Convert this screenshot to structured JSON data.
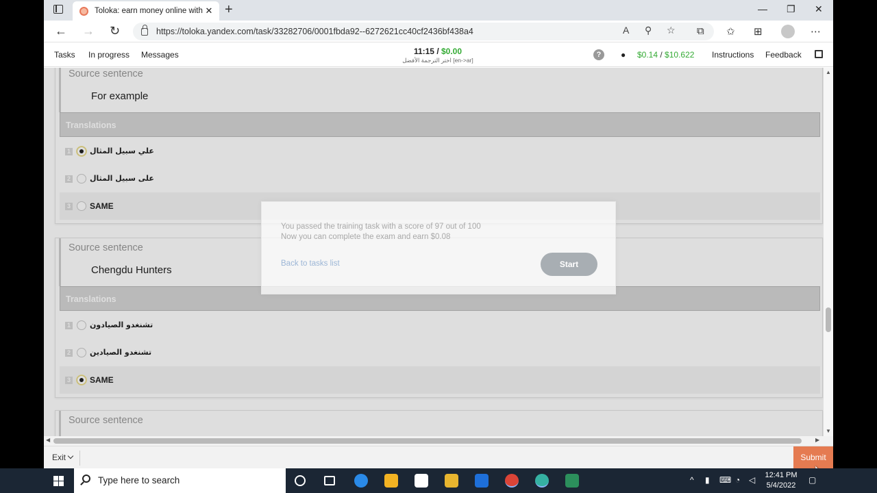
{
  "browser": {
    "tab_title": "Toloka: earn money online with a",
    "tab_close": "✕",
    "new_tab": "+",
    "url": "https://toloka.yandex.com/task/33282706/0001fbda92--6272621cc40cf2436bf438a4",
    "window_controls": [
      "—",
      "❐",
      "✕"
    ]
  },
  "toloka": {
    "nav": [
      "Tasks",
      "In progress",
      "Messages"
    ],
    "timer": "11:15",
    "timer_sep": " / ",
    "task_reward": "$0.00",
    "task_name": "اختر الترجمة الأفضل [en->ar]",
    "help": "?",
    "balance_a": "$0.14",
    "balance_sep": " / ",
    "balance_b": "$10.622",
    "instructions": "Instructions",
    "feedback": "Feedback"
  },
  "tasks": [
    {
      "source_label": "Source sentence",
      "source_text": "For example",
      "translations_label": "Translations",
      "options": [
        {
          "num": "1",
          "text": "علي سبيل المثال",
          "selected": true
        },
        {
          "num": "2",
          "text": "على سبيل المثال",
          "selected": false
        },
        {
          "num": "3",
          "text": "SAME",
          "selected": false
        }
      ]
    },
    {
      "source_label": "Source sentence",
      "source_text": "Chengdu Hunters",
      "translations_label": "Translations",
      "options": [
        {
          "num": "1",
          "text": "تشنغدو الصيادون",
          "selected": false
        },
        {
          "num": "2",
          "text": "تشنغدو الصيادين",
          "selected": false
        },
        {
          "num": "3",
          "text": "SAME",
          "selected": true
        }
      ]
    },
    {
      "source_label": "Source sentence"
    }
  ],
  "modal": {
    "line1": "You passed the training task with a score of 97 out of 100",
    "line2": "Now you can complete the exam and earn $0.08",
    "back": "Back to tasks list",
    "start": "Start"
  },
  "bottom": {
    "exit": "Exit",
    "submit": "Submit"
  },
  "taskbar": {
    "search_placeholder": "Type here to search",
    "time": "12:41 PM",
    "date": "5/4/2022"
  },
  "colors": {
    "accent_green": "#33aa33",
    "submit_orange": "#e57b51",
    "taskbar": "#1b2634"
  }
}
